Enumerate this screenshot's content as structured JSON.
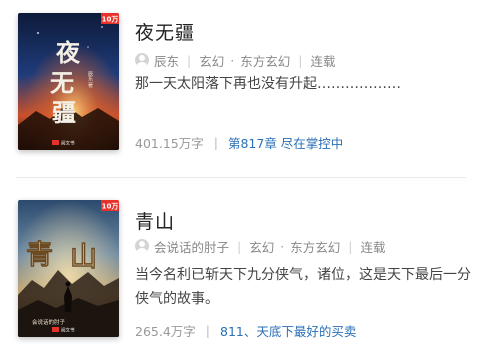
{
  "books": [
    {
      "title": "夜无疆",
      "cover": {
        "art_text": "夜无疆",
        "badge": "10万",
        "author_mark": "辰东 著",
        "publisher": "阅文书"
      },
      "author": "辰东",
      "genre": "玄幻",
      "subgenre": "东方玄幻",
      "status": "连载",
      "description": "那一天太阳落下再也没有升起………………",
      "word_count": "401.15万字",
      "latest_chapter": "第817章 尽在掌控中"
    },
    {
      "title": "青山",
      "cover": {
        "art_text": "青山",
        "badge": "10万",
        "author_mark": "会说话的肘子",
        "publisher": "阅文书"
      },
      "author": "会说话的肘子",
      "genre": "玄幻",
      "subgenre": "东方玄幻",
      "status": "连载",
      "description": "当今名利已斩天下九分侠气，诸位，这是天下最后一分侠气的故事。",
      "word_count": "265.4万字",
      "latest_chapter": "811、天底下最好的买卖"
    }
  ],
  "ui": {
    "separator": "|",
    "dot": "·"
  },
  "colors": {
    "link": "#2b6fb6",
    "muted": "#888888",
    "badge": "#e6322a"
  }
}
